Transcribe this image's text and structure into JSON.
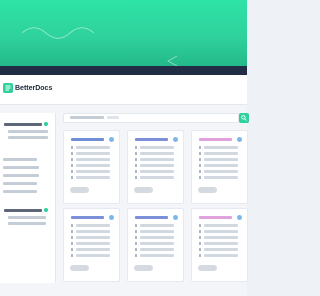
{
  "app": {
    "brand_name": "BetterDocs"
  },
  "colors": {
    "accent": "#2fd29c",
    "hero_dark_band": "#202d44"
  },
  "search": {
    "placeholder": ""
  },
  "sidebar": {
    "sections": 3
  },
  "cards": [
    {
      "accent": "#6f8fd8",
      "dot": "#7db7e8"
    },
    {
      "accent": "#7b8fdb",
      "dot": "#7db7e8"
    },
    {
      "accent": "#dfa2dd",
      "dot": "#7db7e8"
    },
    {
      "accent": "#7b8fdb",
      "dot": "#7db7e8"
    },
    {
      "accent": "#7b8fdb",
      "dot": "#7db7e8"
    },
    {
      "accent": "#dfa2dd",
      "dot": "#7db7e8"
    }
  ]
}
